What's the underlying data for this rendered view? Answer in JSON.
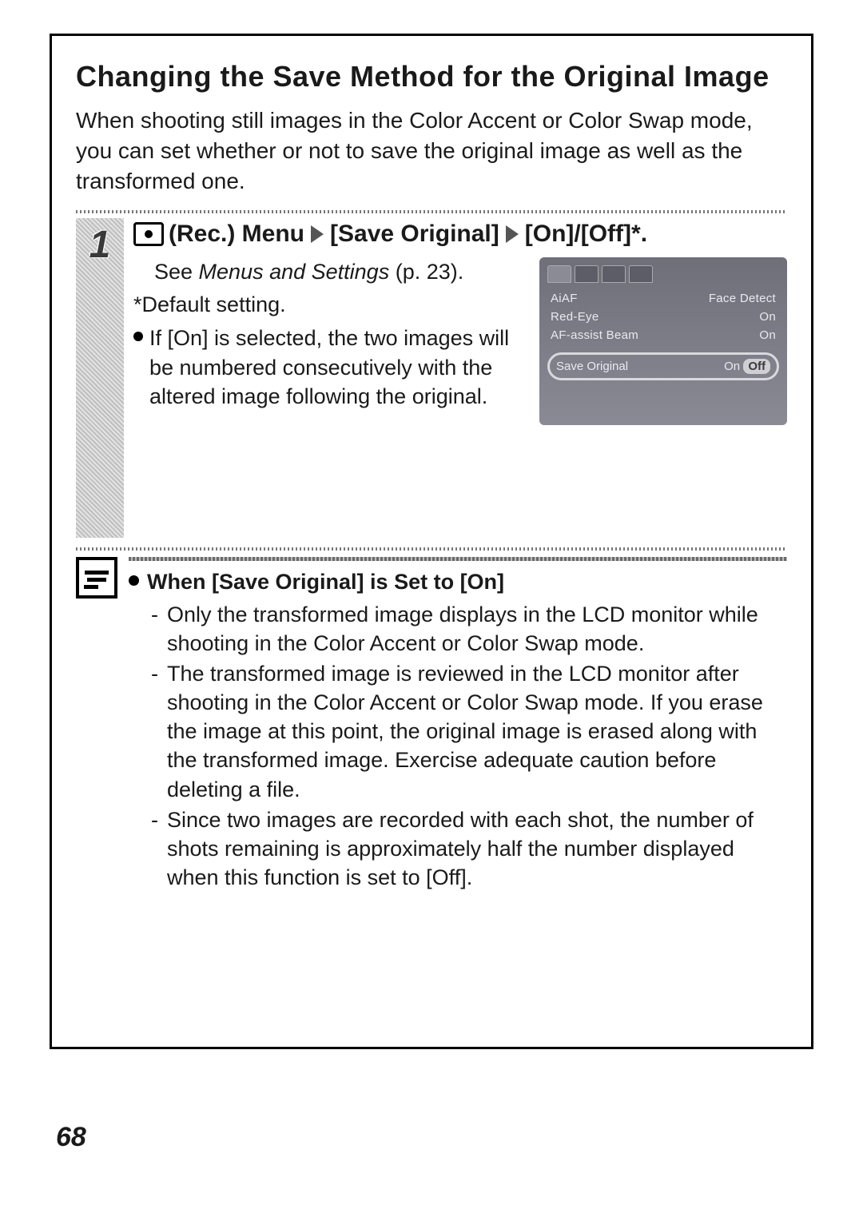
{
  "page_number": "68",
  "title": "Changing the Save Method for the Original Image",
  "intro": "When shooting still images in the Color Accent or Color Swap mode, you can set whether or not to save the original image as well as the transformed one.",
  "step": {
    "number": "1",
    "heading": {
      "part1": "(Rec.) Menu",
      "part2": "[Save Original]",
      "part3": "[On]/[Off]*."
    },
    "see_prefix": "See ",
    "see_italic": "Menus and Settings",
    "see_suffix": " (p. 23).",
    "default_note": "*Default setting.",
    "bullet": "If [On] is selected, the two images will be numbered consecutively with the altered image following the original."
  },
  "screenshot": {
    "rows": [
      {
        "label": "AiAF",
        "value": "Face Detect"
      },
      {
        "label": "Red-Eye",
        "value": "On"
      },
      {
        "label": "AF-assist Beam",
        "value": "On"
      }
    ],
    "highlight_label": "Save Original",
    "highlight_on": "On",
    "highlight_off": "Off"
  },
  "note": {
    "heading": "When [Save Original] is Set to [On]",
    "items": [
      "Only the transformed image displays in the LCD monitor while shooting in the Color Accent or Color Swap mode.",
      "The transformed image is reviewed in the LCD monitor after shooting in the Color Accent or Color Swap mode. If you erase the image at this point, the original image is erased along with the transformed image. Exercise adequate caution before deleting a file.",
      "Since two images are recorded with each shot, the number of shots remaining is approximately half the number displayed when this function is set to [Off]."
    ]
  }
}
